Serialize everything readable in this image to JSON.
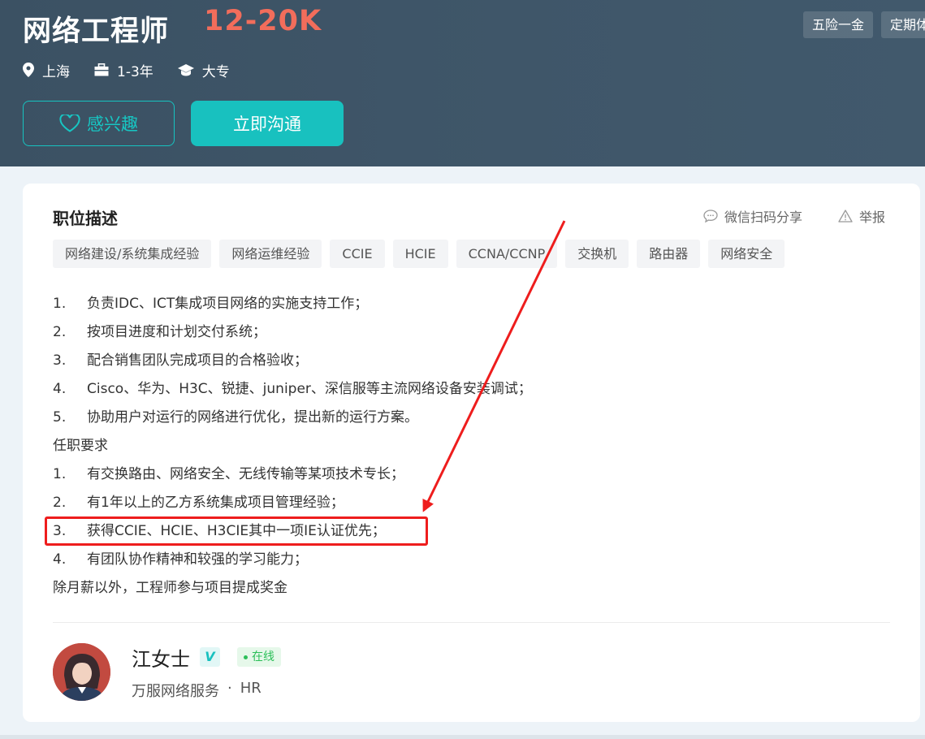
{
  "header": {
    "job_title": "网络工程师",
    "salary": "12-20K",
    "location": "上海",
    "experience": "1-3年",
    "education": "大专",
    "benefits": [
      "五险一金",
      "定期体检"
    ],
    "interest_label": "感兴趣",
    "chat_label": "立即沟通"
  },
  "description": {
    "title": "职位描述",
    "share_label": "微信扫码分享",
    "report_label": "举报",
    "tags": [
      "网络建设/系统集成经验",
      "网络运维经验",
      "CCIE",
      "HCIE",
      "CCNA/CCNP",
      "交换机",
      "路由器",
      "网络安全"
    ],
    "duties": [
      {
        "num": "1.",
        "text": "负责IDC、ICT集成项目网络的实施支持工作；"
      },
      {
        "num": "2.",
        "text": "按项目进度和计划交付系统；"
      },
      {
        "num": "3.",
        "text": "配合销售团队完成项目的合格验收；"
      },
      {
        "num": "4.",
        "text": "Cisco、华为、H3C、锐捷、juniper、深信服等主流网络设备安装调试；"
      },
      {
        "num": "5.",
        "text": "协助用户对运行的网络进行优化，提出新的运行方案。"
      }
    ],
    "requirements_heading": "任职要求",
    "requirements": [
      {
        "num": "1.",
        "text": "有交换路由、网络安全、无线传输等某项技术专长；"
      },
      {
        "num": "2.",
        "text": "有1年以上的乙方系统集成项目管理经验；"
      },
      {
        "num": "3.",
        "text": "获得CCIE、HCIE、H3CIE其中一项IE认证优先；"
      },
      {
        "num": "4.",
        "text": "有团队协作精神和较强的学习能力；"
      }
    ],
    "footer_note": "除月薪以外，工程师参与项目提成奖金"
  },
  "recruiter": {
    "name": "江女士",
    "verified_badge": "V",
    "status": "在线",
    "company": "万服网络服务",
    "separator": "·",
    "role": "HR"
  },
  "colors": {
    "header_bg": "#3f5669",
    "accent": "#18c1bf",
    "salary": "#f26d5b",
    "annotation": "#ee1d1d"
  }
}
